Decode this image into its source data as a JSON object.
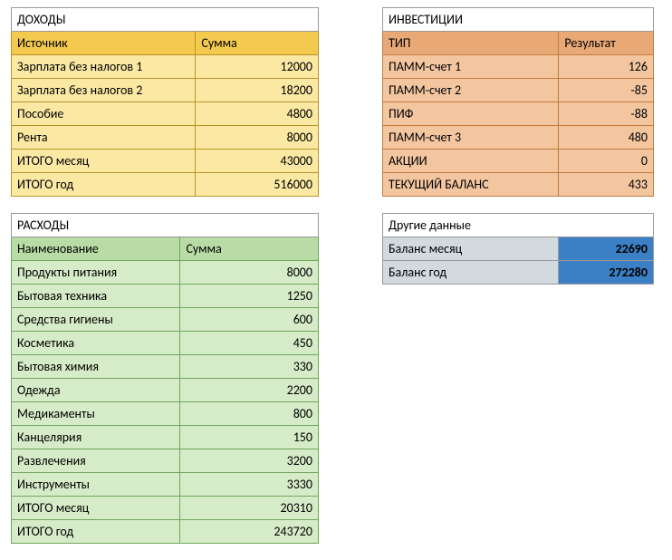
{
  "income": {
    "title": "ДОХОДЫ",
    "col1": "Источник",
    "col2": "Сумма",
    "rows": [
      {
        "label": "Зарплата без налогов 1",
        "value": "12000"
      },
      {
        "label": "Зарплата без налогов 2",
        "value": "18200"
      },
      {
        "label": "Пособие",
        "value": "4800"
      },
      {
        "label": "Рента",
        "value": "8000"
      },
      {
        "label": "ИТОГО месяц",
        "value": "43000"
      },
      {
        "label": "ИТОГО год",
        "value": "516000"
      }
    ]
  },
  "expenses": {
    "title": "РАСХОДЫ",
    "col1": "Наименование",
    "col2": "Сумма",
    "rows": [
      {
        "label": "Продукты питания",
        "value": "8000"
      },
      {
        "label": "Бытовая техника",
        "value": "1250"
      },
      {
        "label": "Средства гигиены",
        "value": "600"
      },
      {
        "label": "Косметика",
        "value": "450"
      },
      {
        "label": "Бытовая химия",
        "value": "330"
      },
      {
        "label": "Одежда",
        "value": "2200"
      },
      {
        "label": "Медикаменты",
        "value": "800"
      },
      {
        "label": "Канцелярия",
        "value": "150"
      },
      {
        "label": "Развлечения",
        "value": "3200"
      },
      {
        "label": "Инструменты",
        "value": "3330"
      },
      {
        "label": "ИТОГО месяц",
        "value": "20310"
      },
      {
        "label": "ИТОГО год",
        "value": "243720"
      }
    ]
  },
  "invest": {
    "title": "ИНВЕСТИЦИИ",
    "col1": "ТИП",
    "col2": "Результат",
    "rows": [
      {
        "label": "ПАММ-счет 1",
        "value": "126"
      },
      {
        "label": "ПАММ-счет 2",
        "value": "-85"
      },
      {
        "label": "ПИФ",
        "value": "-88"
      },
      {
        "label": "ПАММ-счет 3",
        "value": "480"
      },
      {
        "label": "АКЦИИ",
        "value": "0"
      },
      {
        "label": "ТЕКУЩИЙ БАЛАНС",
        "value": "433"
      }
    ]
  },
  "other": {
    "title": "Другие данные",
    "rows": [
      {
        "label": "Баланс месяц",
        "value": "22690"
      },
      {
        "label": "Баланс год",
        "value": "272280"
      }
    ]
  }
}
